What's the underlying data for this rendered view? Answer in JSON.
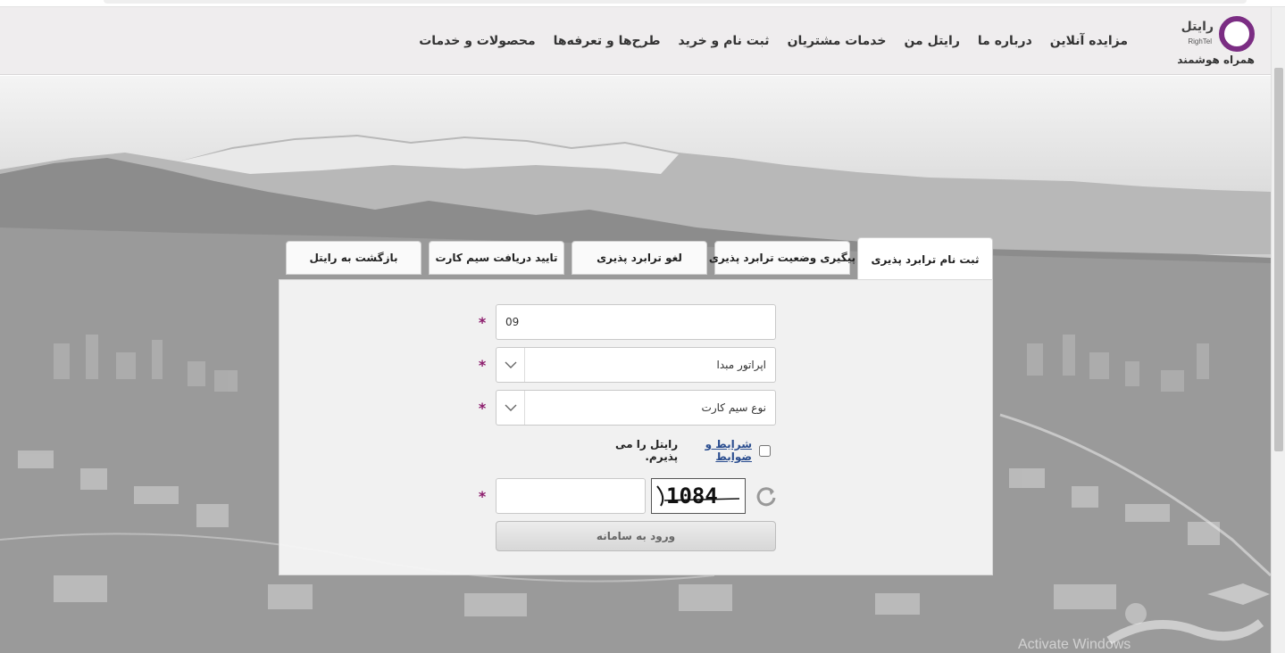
{
  "brand": {
    "name": "رایتل",
    "latin": "RighTel",
    "tagline": "همراه هوشمند",
    "color": "#7b2d83"
  },
  "nav": {
    "items": [
      {
        "label": "محصولات و خدمات"
      },
      {
        "label": "طرح‌ها و تعرفه‌ها"
      },
      {
        "label": "ثبت نام و خرید"
      },
      {
        "label": "خدمات مشتریان"
      },
      {
        "label": "رایتل من"
      },
      {
        "label": "درباره ما"
      },
      {
        "label": "مزایده آنلاین"
      }
    ]
  },
  "tabs": [
    {
      "label": "ثبت نام ترابرد پذیری",
      "active": true
    },
    {
      "label": "پیگیری وضعیت ترابرد پذیری",
      "active": false
    },
    {
      "label": "لغو ترابرد پذیری",
      "active": false
    },
    {
      "label": "تایید دریافت سیم کارت",
      "active": false
    },
    {
      "label": "بازگشت به رایتل",
      "active": false
    }
  ],
  "form": {
    "phone_value": "09",
    "operator_select": "اپراتور مبدا",
    "simtype_select": "نوع سیم کارت",
    "required_mark": "*",
    "terms_link": "شرایط و ضوابط",
    "terms_text": "رایتل را می پذیرم.",
    "captcha_text": "1084",
    "submit_label": "ورود به سامانه"
  },
  "overlay": {
    "activate_windows": "Activate Windows"
  }
}
